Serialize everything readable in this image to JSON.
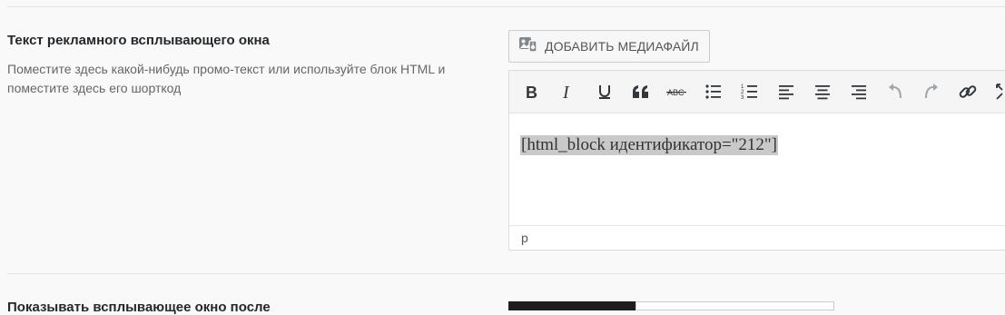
{
  "field": {
    "title": "Текст рекламного всплывающего окна",
    "description": "Поместите здесь какой-нибудь промо-текст или используйте блок HTML и поместите здесь его шорткод"
  },
  "media_button": {
    "label": "ДОБАВИТЬ МЕДИАФАЙЛ",
    "icon": "media-add-icon"
  },
  "toolbar": {
    "buttons": [
      {
        "name": "bold",
        "icon": "bold-icon"
      },
      {
        "name": "italic",
        "icon": "italic-icon"
      },
      {
        "name": "underline",
        "icon": "underline-icon"
      },
      {
        "name": "blockquote",
        "icon": "blockquote-icon"
      },
      {
        "name": "strikethrough",
        "icon": "strikethrough-icon",
        "glyph": "ABC"
      },
      {
        "name": "bullet-list",
        "icon": "bullet-list-icon"
      },
      {
        "name": "numbered-list",
        "icon": "numbered-list-icon"
      },
      {
        "name": "align-left",
        "icon": "align-left-icon"
      },
      {
        "name": "align-center",
        "icon": "align-center-icon"
      },
      {
        "name": "align-right",
        "icon": "align-right-icon"
      },
      {
        "name": "undo",
        "icon": "undo-icon"
      },
      {
        "name": "redo",
        "icon": "redo-icon"
      },
      {
        "name": "link",
        "icon": "link-icon"
      },
      {
        "name": "fullscreen",
        "icon": "fullscreen-icon"
      }
    ]
  },
  "editor": {
    "content": "[html_block идентификатор=\"212\"]",
    "status_path": "p"
  },
  "next_field": {
    "title": "Показывать всплывающее окно после"
  },
  "colors": {
    "background": "#f9f9f9",
    "selection": "#c9c9c9",
    "icon": "#32373c",
    "disabled_icon": "#a0a5aa",
    "swatch_dark": "#1e1e1e"
  }
}
